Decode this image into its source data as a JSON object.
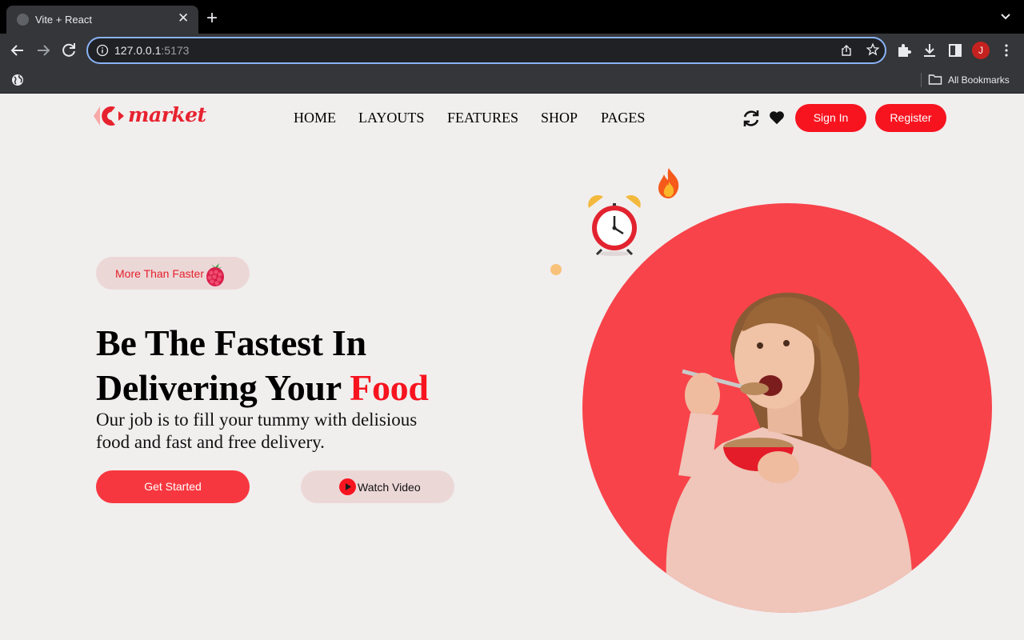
{
  "browser": {
    "tab_title": "Vite + React",
    "url_host": "127.0.0.1",
    "url_port": ":5173",
    "avatar_letter": "J",
    "bookmarks_label": "All Bookmarks"
  },
  "header": {
    "logo_text": "market",
    "nav": [
      "HOME",
      "LAYOUTS",
      "FEATURES",
      "SHOP",
      "PAGES"
    ],
    "sign_in": "Sign In",
    "register": "Register"
  },
  "hero": {
    "badge": "More Than Faster",
    "headline_line1": "Be The Fastest In",
    "headline_line2": "Delivering Your",
    "headline_accent": "Food",
    "subtext_line1": "Our job is to fill your tummy with delisious",
    "subtext_line2": "food and fast and free delivery.",
    "cta_primary": "Get Started",
    "cta_secondary": "Watch Video"
  },
  "colors": {
    "brand_red": "#f7141f",
    "circle_red": "#f8434a",
    "pill_bg": "#ecd7d7",
    "page_bg": "#f1eeee"
  }
}
